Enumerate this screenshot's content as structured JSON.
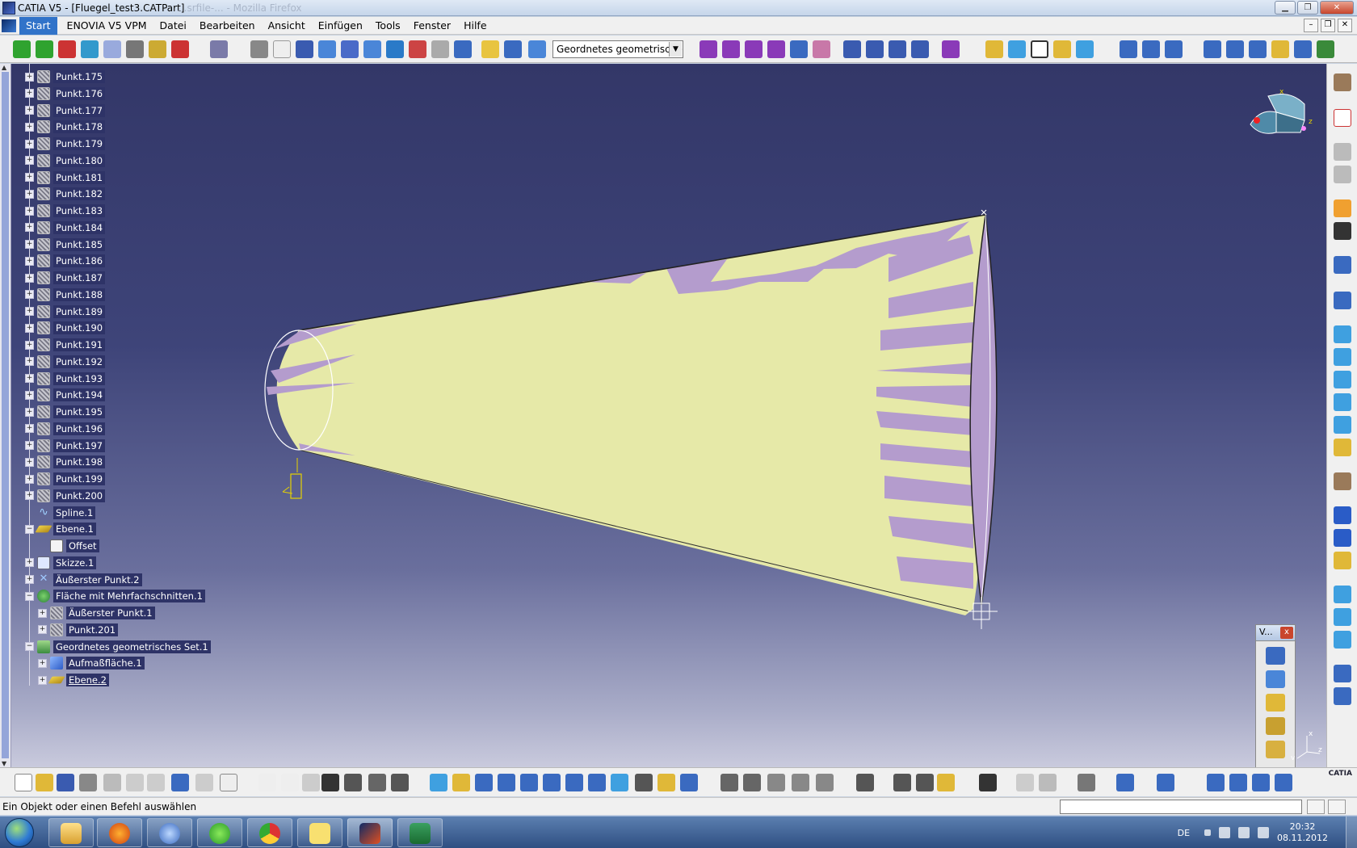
{
  "window": {
    "title": "CATIA V5 - [Fluegel_test3.CATPart]",
    "ghost_title": "...srfile-... - Mozilla Firefox"
  },
  "menu": {
    "items": [
      "Start",
      "ENOVIA V5 VPM",
      "Datei",
      "Bearbeiten",
      "Ansicht",
      "Einfügen",
      "Tools",
      "Fenster",
      "Hilfe"
    ]
  },
  "toolbar": {
    "combo_value": "Geordnetes geometrisches",
    "combo_arrow": "▼"
  },
  "tree": {
    "points": [
      "Punkt.175",
      "Punkt.176",
      "Punkt.177",
      "Punkt.178",
      "Punkt.179",
      "Punkt.180",
      "Punkt.181",
      "Punkt.182",
      "Punkt.183",
      "Punkt.184",
      "Punkt.185",
      "Punkt.186",
      "Punkt.187",
      "Punkt.188",
      "Punkt.189",
      "Punkt.190",
      "Punkt.191",
      "Punkt.192",
      "Punkt.193",
      "Punkt.194",
      "Punkt.195",
      "Punkt.196",
      "Punkt.197",
      "Punkt.198",
      "Punkt.199",
      "Punkt.200"
    ],
    "spline": "Spline.1",
    "plane1": "Ebene.1",
    "offset": "Offset",
    "sketch": "Skizze.1",
    "extreme2": "Äußerster Punkt.2",
    "loft": "Fläche mit Mehrfachschnitten.1",
    "extreme1": "Äußerster Punkt.1",
    "point201": "Punkt.201",
    "geoset": "Geordnetes geometrisches Set.1",
    "offsetsurf": "Aufmaßfläche.1",
    "plane2": "Ebene.2"
  },
  "compass": {
    "x": "x",
    "z": "z"
  },
  "float_toolbar": {
    "title": "V...",
    "close": "x"
  },
  "axis_mini": {
    "x": "x",
    "y": "y",
    "z": "z"
  },
  "brand": {
    "logo_text": "CATIA"
  },
  "status": {
    "message": "Ein Objekt oder einen Befehl auswählen"
  },
  "taskbar": {
    "lang": "DE",
    "time": "20:32",
    "date": "08.11.2012"
  },
  "colors": {
    "viewport_top": "#333768",
    "surface": "#e8ecaa",
    "surface_inner": "#b49ccd",
    "selection": "#2e3367"
  }
}
